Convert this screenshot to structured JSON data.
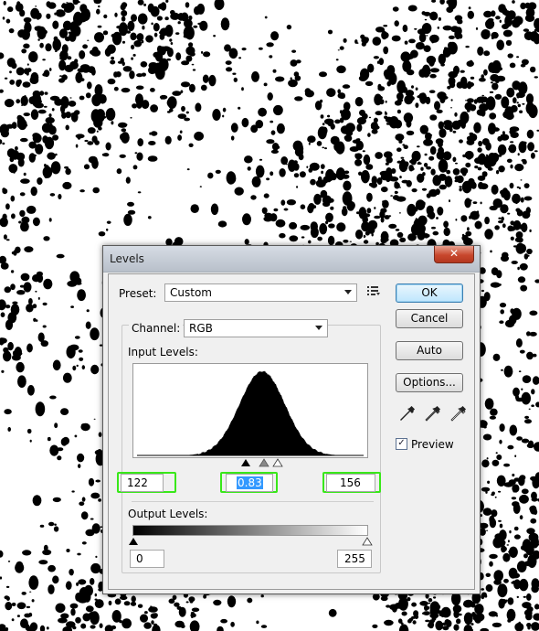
{
  "dialog": {
    "title": "Levels",
    "close_glyph": "✕",
    "preset_label": "Preset:",
    "preset_value": "Custom",
    "preset_menu_icon": "presets-menu-icon",
    "channel_label": "Channel:",
    "channel_value": "RGB",
    "input_levels_label": "Input Levels:",
    "input_black": "122",
    "input_gamma": "0.83",
    "input_white": "156",
    "output_levels_label": "Output Levels:",
    "output_black": "0",
    "output_white": "255",
    "buttons": {
      "ok": "OK",
      "cancel": "Cancel",
      "auto": "Auto",
      "options": "Options..."
    },
    "preview_label": "Preview",
    "preview_checked": true,
    "eyedroppers": [
      "black-eyedropper-icon",
      "gray-eyedropper-icon",
      "white-eyedropper-icon"
    ],
    "highlight_color": "#39e81a",
    "selection_color": "#3399ff"
  }
}
